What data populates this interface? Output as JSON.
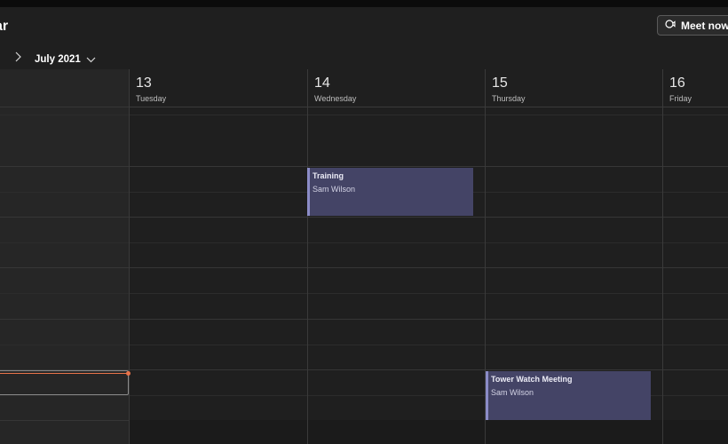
{
  "app": {
    "title_fragment": "ar"
  },
  "header": {
    "meet_now_label": "Meet now",
    "month_label": "July 2021"
  },
  "days": [
    {
      "number": "13",
      "name": "Tuesday"
    },
    {
      "number": "14",
      "name": "Wednesday"
    },
    {
      "number": "15",
      "name": "Thursday"
    },
    {
      "number": "16",
      "name": "Friday"
    }
  ],
  "events": [
    {
      "title": "Training",
      "organizer": "Sam Wilson",
      "day": "14"
    },
    {
      "title": "Tower Watch Meeting",
      "organizer": "Sam Wilson",
      "day": "15"
    }
  ],
  "colors": {
    "background": "#1f1f1f",
    "event_fill": "#444466",
    "event_accent": "#8b8cc7",
    "current_time": "#e8734a"
  },
  "icons": {
    "meet_now": "video-camera-icon",
    "nav_next": "chevron-right-icon",
    "month_dropdown": "chevron-down-icon"
  }
}
